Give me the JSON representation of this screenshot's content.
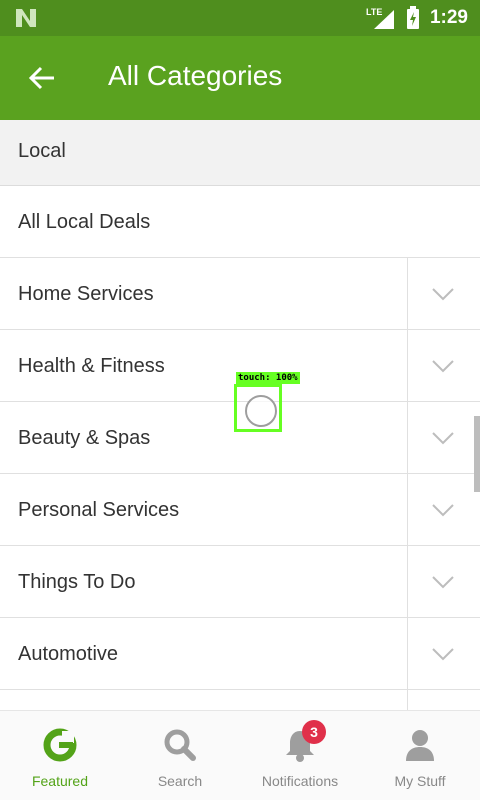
{
  "status_bar": {
    "network": "LTE",
    "time": "1:29"
  },
  "app_bar": {
    "title": "All Categories"
  },
  "list": {
    "header": "Local",
    "items": [
      {
        "label": "All Local Deals",
        "expandable": false
      },
      {
        "label": "Home Services",
        "expandable": true
      },
      {
        "label": "Health & Fitness",
        "expandable": true
      },
      {
        "label": "Beauty & Spas",
        "expandable": true
      },
      {
        "label": "Personal Services",
        "expandable": true
      },
      {
        "label": "Things To Do",
        "expandable": true
      },
      {
        "label": "Automotive",
        "expandable": true
      }
    ]
  },
  "touch_indicator": {
    "label": "touch: 100%"
  },
  "bottom_nav": {
    "tabs": [
      {
        "label": "Featured",
        "icon": "groupon-g-icon",
        "active": true
      },
      {
        "label": "Search",
        "icon": "search-icon",
        "active": false
      },
      {
        "label": "Notifications",
        "icon": "bell-icon",
        "active": false
      },
      {
        "label": "My Stuff",
        "icon": "person-icon",
        "active": false
      }
    ],
    "notifications_badge": "3"
  },
  "colors": {
    "accent": "#5aa21f",
    "status_bar": "#4f8e1e",
    "badge": "#e0304a",
    "active_tab": "#53a318"
  }
}
